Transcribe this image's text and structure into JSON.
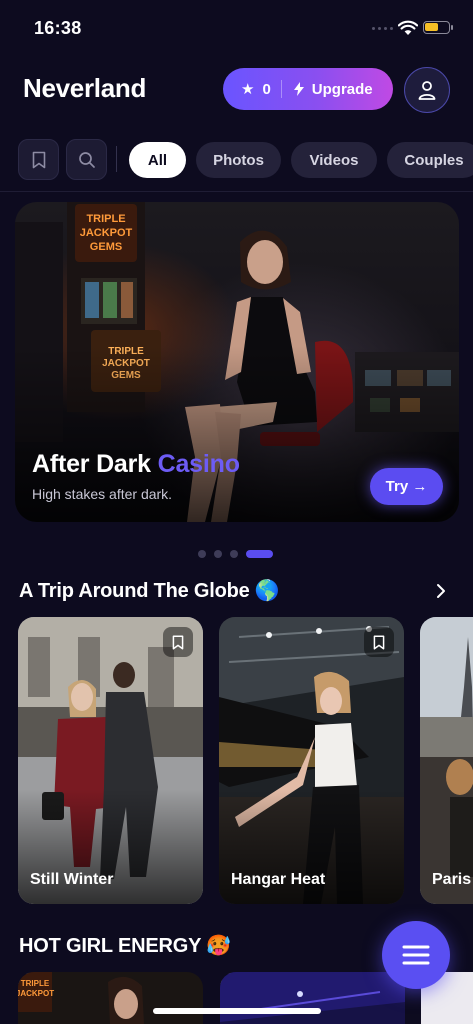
{
  "status_bar": {
    "time": "16:38"
  },
  "header": {
    "brand": "Neverland",
    "stars_count": "0",
    "upgrade_label": "Upgrade"
  },
  "filters": {
    "chips": [
      "All",
      "Photos",
      "Videos",
      "Couples"
    ],
    "active": "All"
  },
  "hero": {
    "title_main": "After Dark",
    "title_accent": "Casino",
    "subtitle": "High stakes after dark.",
    "try_label": "Try →",
    "carousel_active_index": 3,
    "carousel_count": 4
  },
  "sections": [
    {
      "title": "A Trip Around The Globe 🌎",
      "cards": [
        "Still Winter",
        "Hangar Heat",
        "Paris"
      ]
    },
    {
      "title": "HOT GIRL ENERGY 🥵",
      "cards": []
    }
  ],
  "colors": {
    "background": "#0d0b1f",
    "accent": "#5b4cf1",
    "accent_text": "#6d5cf5"
  },
  "icons": [
    "bookmark-icon",
    "search-icon",
    "user-icon",
    "star-icon",
    "bolt-icon",
    "chevron-right-icon",
    "menu-icon"
  ]
}
